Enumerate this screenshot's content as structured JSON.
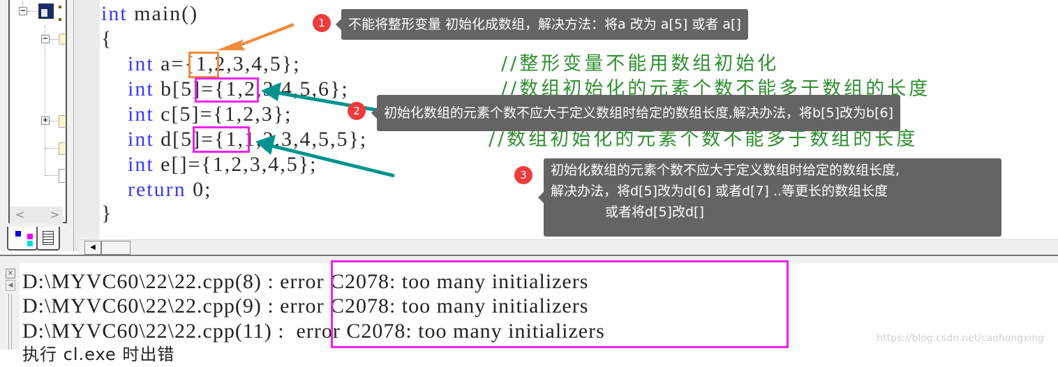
{
  "editor": {
    "lines": [
      {
        "kw": "int",
        "rest": " main()"
      },
      {
        "kw": "",
        "rest": "{"
      },
      {
        "kw": "    int",
        "rest": " a={1,2,3,4,5};",
        "comment": "//整形变量不能用数组初始化"
      },
      {
        "kw": "    int",
        "rest": " b[5]={1,2,3,4,5,6};",
        "comment": "//数组初始化的元素个数不能多于数组的长度"
      },
      {
        "kw": "    int",
        "rest": " c[5]={1,2,3};"
      },
      {
        "kw": "    int",
        "rest": " d[5]={1,1,2,3,4,5,5};",
        "comment": "//数组初始化的元素个数不能多于数组的长度"
      },
      {
        "kw": "    int",
        "rest": " e[]={1,2,3,4,5};"
      },
      {
        "kw": "    return",
        "rest": " 0;"
      },
      {
        "kw": "",
        "rest": "}"
      }
    ]
  },
  "annotations": [
    {
      "number": "1",
      "text": "不能将整形变量 初始化成数组，解决方法：将a 改为 a[5]  或者 a[]",
      "color": "#f08a3c"
    },
    {
      "number": "2",
      "text": "初始化数组的元素个数不应大于定义数组时给定的数组长度,解决办法，将b[5]改为b[6]",
      "color": "#00938f"
    },
    {
      "number": "3",
      "lines": [
        "初始化数组的元素个数不应大于定义数组时给定的数组长度,",
        "解决办法，将d[5]改为d[6] 或者d[7] ..等更长的数组长度",
        "或者将d[5]改d[]"
      ],
      "color": "#00938f"
    }
  ],
  "highlight_colors": {
    "orange": "#f08a3c",
    "magenta": "#ee22ee",
    "teal": "#00938f",
    "badge": "#ef3b3b"
  },
  "output": {
    "lines": [
      {
        "path": "D:\\MYVC60\\22\\22.cpp(8) ",
        "sep": ": ",
        "msg": "error C2078: too many initializers"
      },
      {
        "path": "D:\\MYVC60\\22\\22.cpp(9) ",
        "sep": ": ",
        "msg": "error C2078: too many initializers"
      },
      {
        "path": "D:\\MYVC60\\22\\22.cpp(11) ",
        "sep": ": ",
        "msg": " error C2078: too many initializers"
      },
      {
        "path": "执行 cl.exe 时出错",
        "sep": "",
        "msg": ""
      }
    ]
  },
  "workspace": {
    "tabs": [
      "class-view",
      "file-view"
    ]
  },
  "watermark": "https://blog.csdn.net/caohongxing"
}
